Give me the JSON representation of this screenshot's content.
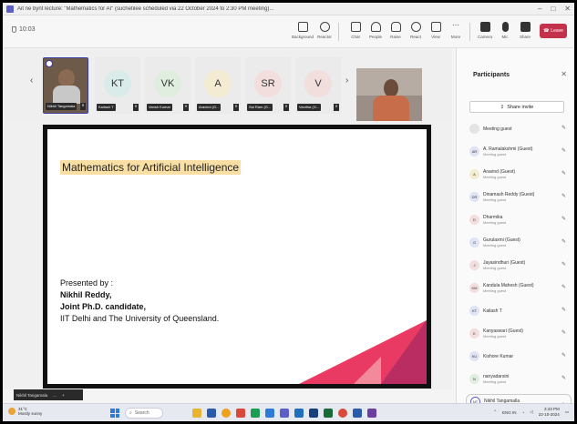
{
  "window": {
    "title": "Ait ne bynt lecture: \"Mathematics for AI\" (suchetilee scheduled via 22 October 2024 to 2:30 PM meeting)...",
    "controls": [
      "–",
      "□",
      "✕"
    ]
  },
  "toolbar": {
    "timer": "10:03",
    "buttons": [
      {
        "label": "Background"
      },
      {
        "label": "Reactor"
      },
      {
        "label": "Chat"
      },
      {
        "label": "People"
      },
      {
        "label": "Raise"
      },
      {
        "label": "React"
      },
      {
        "label": "View"
      },
      {
        "label": "More"
      },
      {
        "label": "Camera"
      },
      {
        "label": "Mic"
      },
      {
        "label": "Share"
      }
    ],
    "leave_label": "Leave"
  },
  "strip": {
    "tiles": [
      {
        "type": "video",
        "name": "Nikhil Tangamala"
      },
      {
        "type": "avatar",
        "initials": "KT",
        "name": "Kailash T",
        "color": "teal"
      },
      {
        "type": "avatar",
        "initials": "VK",
        "name": "Vansh Kumar",
        "color": "green"
      },
      {
        "type": "avatar",
        "initials": "A",
        "name": "Aravind (G...",
        "color": "yellow"
      },
      {
        "type": "avatar",
        "initials": "SR",
        "name": "Sai Ram (G...",
        "color": "pink"
      },
      {
        "type": "avatar",
        "initials": "V",
        "name": "Vanitha (G...",
        "color": "pink"
      }
    ]
  },
  "slide": {
    "title": "Mathematics for Artificial Intelligence",
    "presented_by": "Presented by :",
    "presenter": "Nikhil Reddy,",
    "role": "Joint Ph.D. candidate,",
    "affiliation": "IIT Delhi and The University of Queensland."
  },
  "share_bar": {
    "label": "Nikhil Tangamala",
    "more": "...",
    "add": "+"
  },
  "participants": {
    "title": "Participants",
    "share_invite": "Share invite",
    "list": [
      {
        "initials": "",
        "name": "Meeting guest",
        "role": "",
        "color": "#e4e4e4"
      },
      {
        "initials": "AR",
        "name": "A. Ramalakshmi (Guest)",
        "role": "Meeting guest",
        "color": "#dfe3f4"
      },
      {
        "initials": "A",
        "name": "Aravind (Guest)",
        "role": "Meeting guest",
        "color": "#f4ecd2"
      },
      {
        "initials": "DR",
        "name": "Dinamash Reddy (Guest)",
        "role": "Meeting guest",
        "color": "#dfe3f4"
      },
      {
        "initials": "D",
        "name": "Dharmika",
        "role": "Meeting guest",
        "color": "#f3dede"
      },
      {
        "initials": "G",
        "name": "Gurulaxmi (Guest)",
        "role": "Meeting guest",
        "color": "#dfe3f4"
      },
      {
        "initials": "J",
        "name": "Jayasindhuri (Guest)",
        "role": "Meeting guest",
        "color": "#f3dede"
      },
      {
        "initials": "KM",
        "name": "Kandula Mahesh (Guest)",
        "role": "Meeting guest",
        "color": "#f3dede"
      },
      {
        "initials": "KT",
        "name": "Kailash T",
        "role": "",
        "color": "#dfe3f4"
      },
      {
        "initials": "K",
        "name": "Kanyaswari (Guest)",
        "role": "Meeting guest",
        "color": "#f3dede"
      },
      {
        "initials": "KU",
        "name": "Kishore Kumar",
        "role": "",
        "color": "#dfe3f4"
      },
      {
        "initials": "N",
        "name": "nanyadarsini",
        "role": "Meeting guest",
        "color": "#dfeede"
      },
      {
        "initials": "NT",
        "name": "Nikhil Tangamalla",
        "role": "",
        "color": "#fff",
        "me": true
      }
    ]
  },
  "taskbar": {
    "weather_temp": "31°C",
    "weather_desc": "Mostly sunny",
    "search_placeholder": "Search",
    "lang": "ENG IN",
    "time": "3:43 PM",
    "date": "22-10-2024"
  },
  "colors": {
    "accent": "#5b5fc7",
    "leave": "#c4314b",
    "highlight": "#f9dfa3",
    "deco_pink": "#e83a62"
  }
}
